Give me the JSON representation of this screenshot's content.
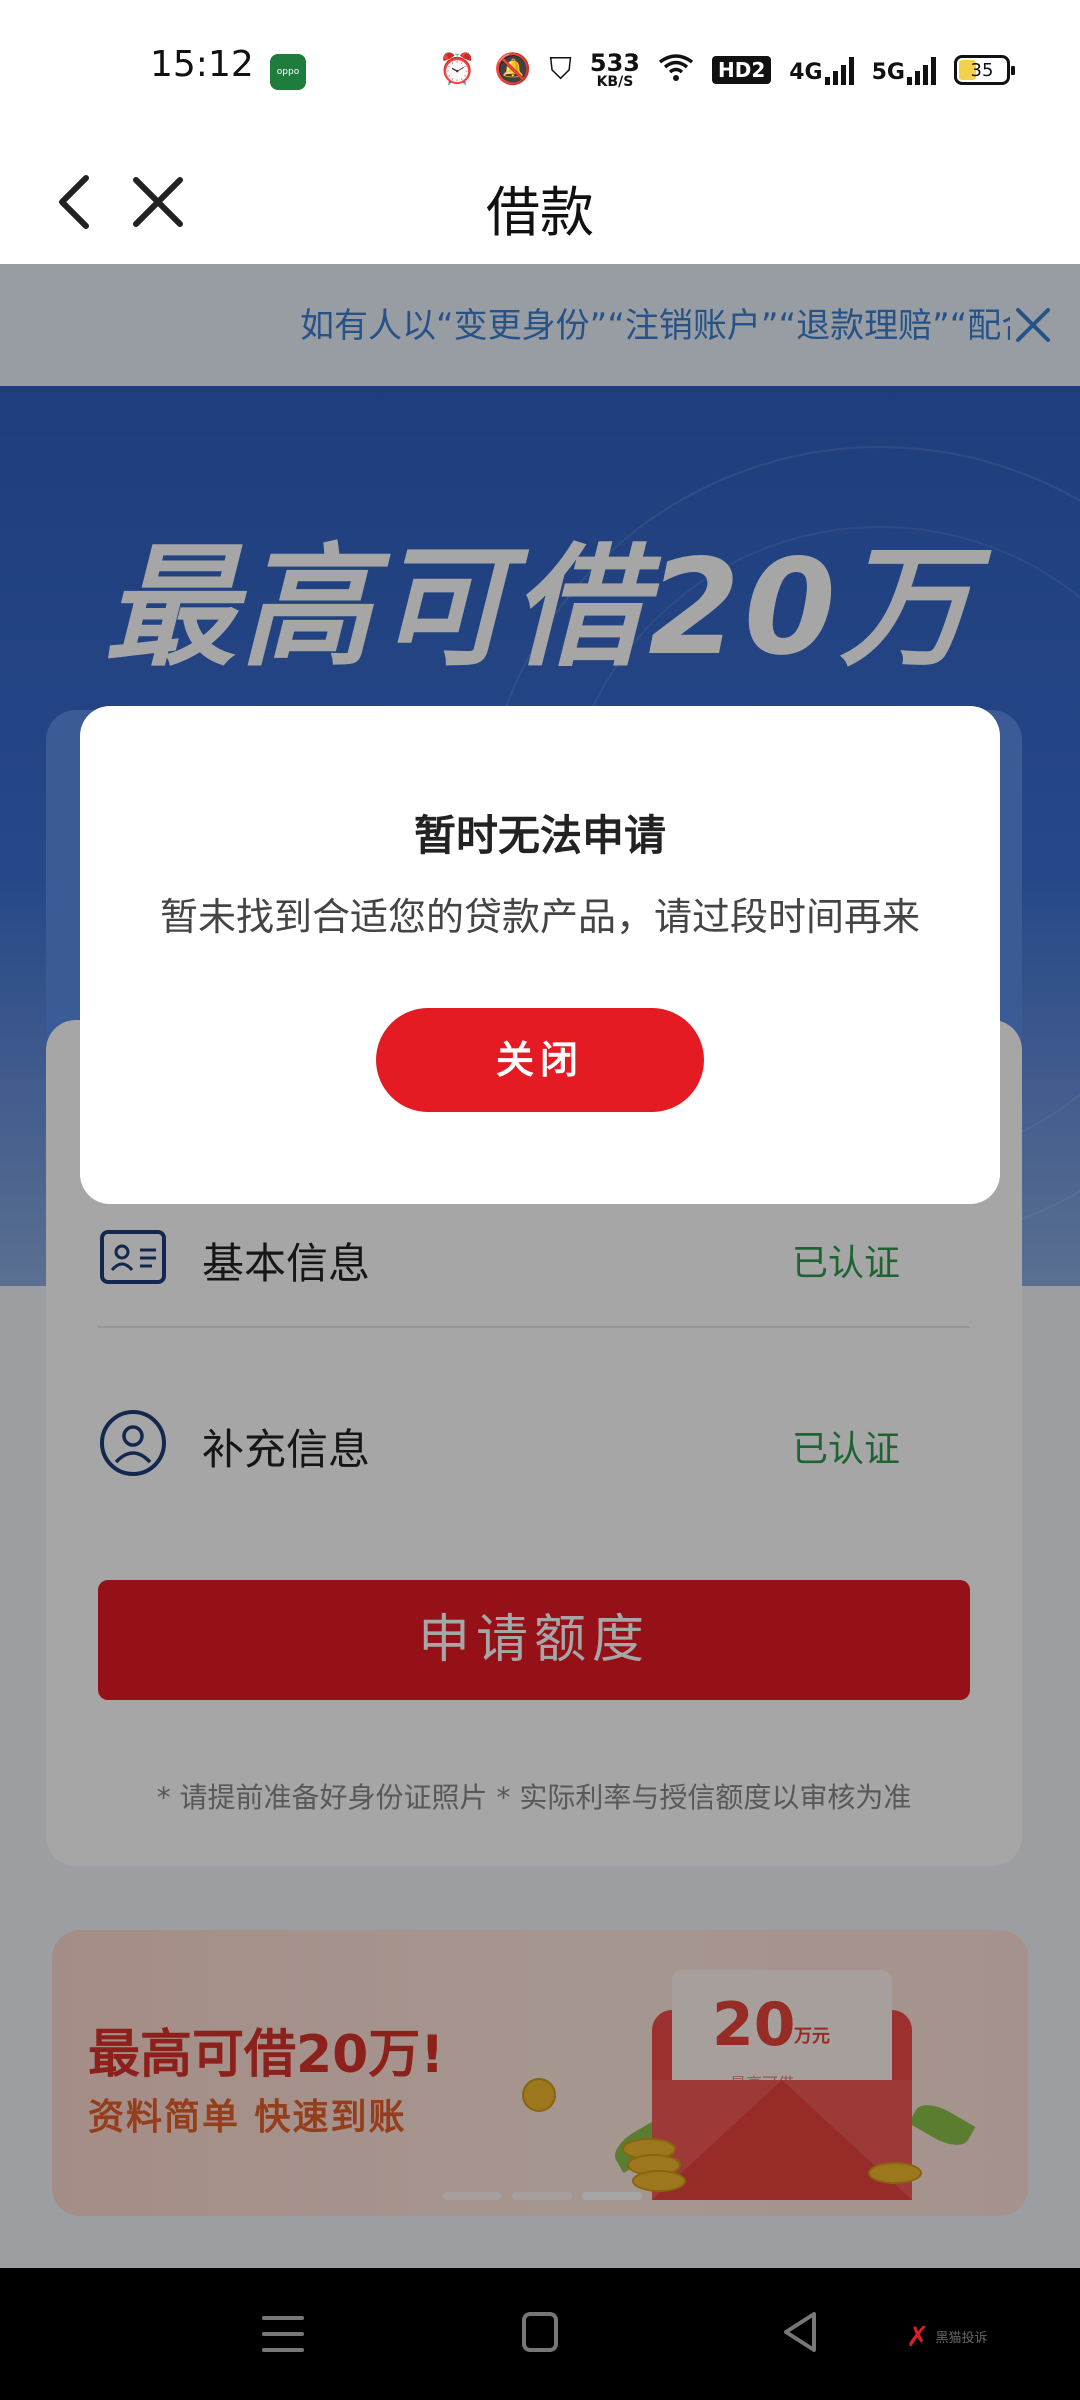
{
  "status_bar": {
    "time": "15:12",
    "app_badge": "oppo",
    "net_speed": "533",
    "net_unit": "KB/S",
    "hd_label": "HD2",
    "signal_1": "4G",
    "signal_2": "5G",
    "battery": "35"
  },
  "nav": {
    "title": "借款"
  },
  "notice": {
    "text": "如有人以“变更身份”“注销账户”“退款理赔”“配合"
  },
  "hero": {
    "title": "最高可借20万"
  },
  "form": {
    "rows": [
      {
        "label": "基本信息",
        "status": "已认证"
      },
      {
        "label": "补充信息",
        "status": "已认证"
      }
    ],
    "apply_button": "申请额度",
    "tip": "* 请提前准备好身份证照片 * 实际利率与授信额度以审核为准"
  },
  "banner": {
    "title": "最高可借20万!",
    "subtitle": "资料简单  快速到账",
    "envelope_amount": "20",
    "envelope_unit": "万元",
    "envelope_caption": "最高可借"
  },
  "dialog": {
    "title": "暂时无法申请",
    "message": "暂未找到合适您的贷款产品，请过段时间再来",
    "close_button": "关闭"
  },
  "watermark": {
    "text": "黑猫投诉"
  }
}
